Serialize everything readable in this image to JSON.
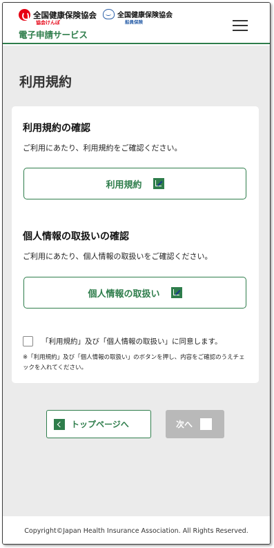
{
  "header": {
    "logo1_text": "全国健康保険協会",
    "logo1_sub": "協会けんぽ",
    "logo2_text": "全国健康保険協会",
    "logo2_sub": "船員保険",
    "service_title": "電子申請サービス"
  },
  "page": {
    "title": "利用規約"
  },
  "terms": {
    "title": "利用規約の確認",
    "desc": "ご利用にあたり、利用規約をご確認ください。",
    "button_label": "利用規約"
  },
  "privacy": {
    "title": "個人情報の取扱いの確認",
    "desc": "ご利用にあたり、個人情報の取扱いをご確認ください。",
    "button_label": "個人情報の取扱い"
  },
  "agreement": {
    "checkbox_label": "「利用規約」及び「個人情報の取扱い」に同意します。",
    "checked": false,
    "note": "※「利用規約」及び「個人情報の取扱い」のボタンを押し、内容をご確認のうえチェックを入れてください。"
  },
  "nav": {
    "top_label": "トップページへ",
    "next_label": "次へ"
  },
  "footer": {
    "copyright": "Copyright©Japan Health Insurance Association. All Rights Reserved."
  },
  "colors": {
    "accent": "#2e7d4b",
    "brand_red": "#e60012",
    "disabled": "#b9b9b9"
  }
}
